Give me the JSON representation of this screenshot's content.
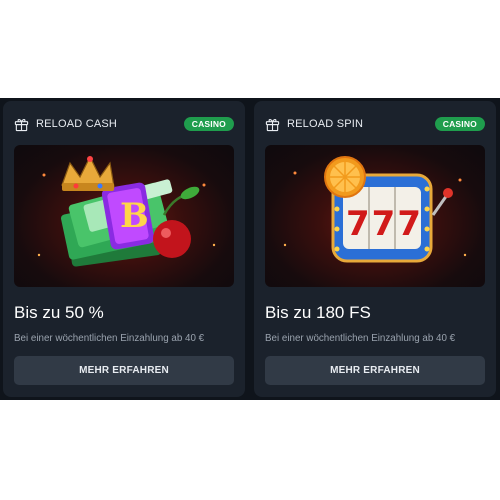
{
  "offers": [
    {
      "title": "RELOAD CASH",
      "badge": "CASINO",
      "headline": "Bis zu 50 %",
      "description": "Bei einer wöchentlichen Einzahlung ab 40 €",
      "button": "MEHR ERFAHREN",
      "illustration": "crown-cash-cherry"
    },
    {
      "title": "RELOAD SPIN",
      "badge": "CASINO",
      "headline": "Bis zu 180 FS",
      "description": "Bei einer wöchentlichen Einzahlung ab 40 €",
      "button": "MEHR ERFAHREN",
      "illustration": "slot-machine-777",
      "reels_text": "777"
    }
  ],
  "colors": {
    "page": "#ffffff",
    "band": "#0f141b",
    "card": "#1b222c",
    "badge": "#1f9d4d",
    "button": "#313a46",
    "muted_text": "#9aa3ae"
  },
  "icons": [
    "gift-icon"
  ]
}
